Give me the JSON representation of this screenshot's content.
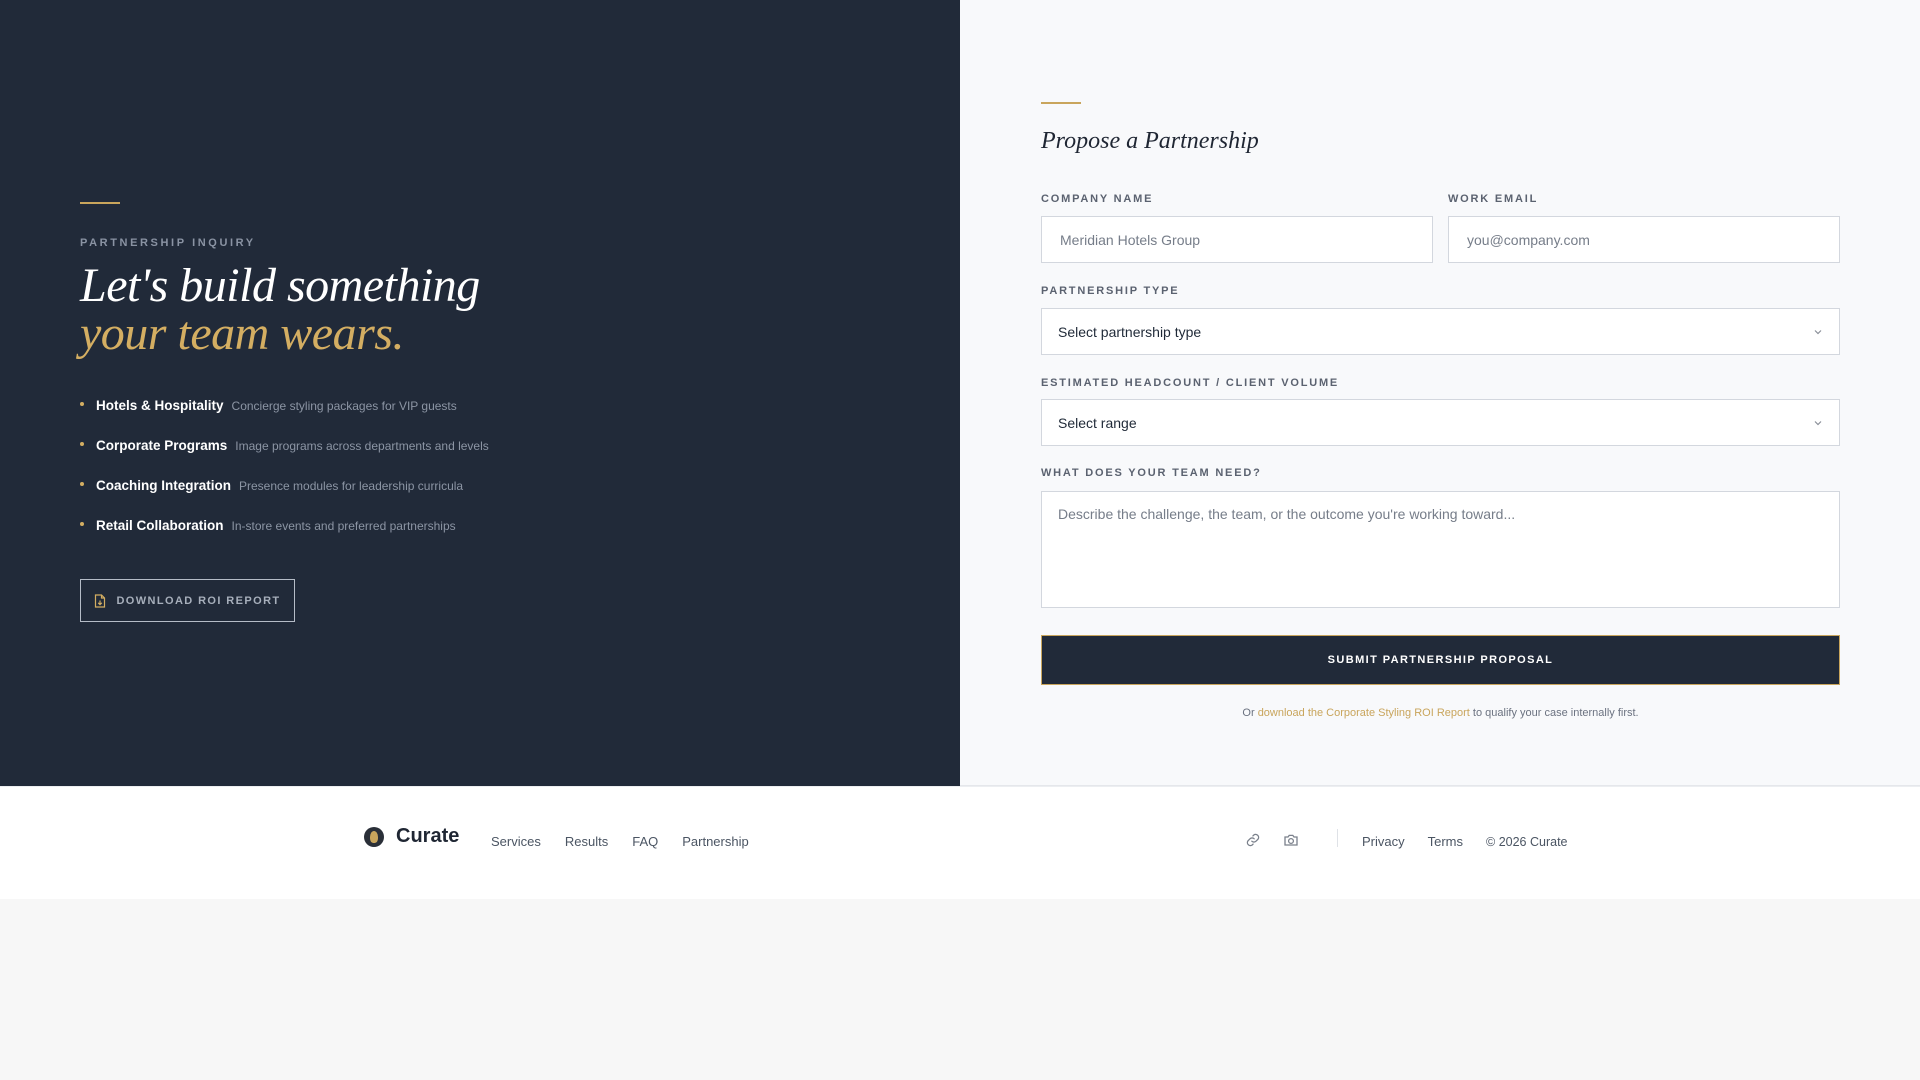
{
  "colors": {
    "navy": "#212a39",
    "gold": "#c9a55c",
    "gold_text": "#d4ae62",
    "panel": "#f8f9fb"
  },
  "left": {
    "eyebrow": "PARTNERSHIP INQUIRY",
    "headline_line1": "Let's build something",
    "headline_line2": "your team wears.",
    "features": [
      {
        "title": "Hotels & Hospitality",
        "desc": "Concierge styling packages for VIP guests"
      },
      {
        "title": "Corporate Programs",
        "desc": "Image programs across departments and levels"
      },
      {
        "title": "Coaching Integration",
        "desc": "Presence modules for leadership curricula"
      },
      {
        "title": "Retail Collaboration",
        "desc": "In-store events and preferred partnerships"
      }
    ],
    "roi_button": {
      "label": "DOWNLOAD ROI REPORT",
      "icon": "document-icon"
    }
  },
  "form": {
    "title": "Propose a Partnership",
    "company": {
      "label": "COMPANY NAME",
      "placeholder": "Meridian Hotels Group"
    },
    "email": {
      "label": "WORK EMAIL",
      "placeholder": "you@company.com"
    },
    "type": {
      "label": "PARTNERSHIP TYPE",
      "value": "Select partnership type"
    },
    "headcount": {
      "label": "ESTIMATED HEADCOUNT / CLIENT VOLUME",
      "value": "Select range"
    },
    "needs": {
      "label": "WHAT DOES YOUR TEAM NEED?",
      "placeholder": "Describe the challenge, the team, or the outcome you're working toward..."
    },
    "submit_label": "SUBMIT PARTNERSHIP PROPOSAL",
    "note_prefix": "Or",
    "note_link": "download the Corporate Styling ROI Report",
    "note_suffix": "to qualify your case internally first."
  },
  "footer": {
    "brand": "Curate",
    "nav": [
      "Services",
      "Results",
      "FAQ",
      "Partnership"
    ],
    "icons": [
      "link-icon",
      "camera-icon"
    ],
    "links": [
      "Privacy",
      "Terms"
    ],
    "copyright": "© 2026 Curate"
  }
}
